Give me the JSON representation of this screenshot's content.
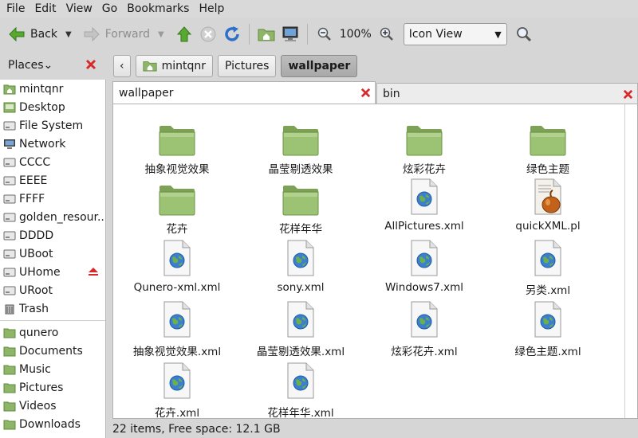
{
  "menu": [
    "File",
    "Edit",
    "View",
    "Go",
    "Bookmarks",
    "Help"
  ],
  "toolbar": {
    "back_label": "Back",
    "forward_label": "Forward",
    "zoom": "100%",
    "view_mode": "Icon View"
  },
  "sidebar": {
    "title": "Places",
    "items": [
      {
        "label": "mintqnr",
        "icon": "home-folder-icon"
      },
      {
        "label": "Desktop",
        "icon": "desktop-icon"
      },
      {
        "label": "File System",
        "icon": "drive-icon"
      },
      {
        "label": "Network",
        "icon": "network-icon"
      },
      {
        "label": "CCCC",
        "icon": "drive-icon"
      },
      {
        "label": "EEEE",
        "icon": "drive-icon"
      },
      {
        "label": "FFFF",
        "icon": "drive-icon"
      },
      {
        "label": "golden_resour...",
        "icon": "drive-icon"
      },
      {
        "label": "DDDD",
        "icon": "drive-icon"
      },
      {
        "label": "UBoot",
        "icon": "drive-icon"
      },
      {
        "label": "UHome",
        "icon": "drive-icon"
      },
      {
        "label": "URoot",
        "icon": "drive-icon"
      },
      {
        "label": "Trash",
        "icon": "trash-icon"
      }
    ],
    "bookmarks": [
      {
        "label": "qunero",
        "icon": "folder-icon"
      },
      {
        "label": "Documents",
        "icon": "folder-icon"
      },
      {
        "label": "Music",
        "icon": "folder-icon"
      },
      {
        "label": "Pictures",
        "icon": "folder-icon"
      },
      {
        "label": "Videos",
        "icon": "folder-icon"
      },
      {
        "label": "Downloads",
        "icon": "folder-icon"
      }
    ]
  },
  "path": [
    "mintqnr",
    "Pictures",
    "wallpaper"
  ],
  "tabs": [
    {
      "label": "wallpaper",
      "active": true
    },
    {
      "label": "bin",
      "active": false
    }
  ],
  "files": [
    {
      "name": "抽象视觉效果",
      "type": "folder"
    },
    {
      "name": "晶莹剔透效果",
      "type": "folder"
    },
    {
      "name": "炫彩花卉",
      "type": "folder"
    },
    {
      "name": "绿色主题",
      "type": "folder"
    },
    {
      "name": "花卉",
      "type": "folder"
    },
    {
      "name": "花样年华",
      "type": "folder"
    },
    {
      "name": "AllPictures.xml",
      "type": "xml"
    },
    {
      "name": "quickXML.pl",
      "type": "perl"
    },
    {
      "name": "Qunero-xml.xml",
      "type": "xml"
    },
    {
      "name": "sony.xml",
      "type": "xml"
    },
    {
      "name": "Windows7.xml",
      "type": "xml"
    },
    {
      "name": "另类.xml",
      "type": "xml"
    },
    {
      "name": "抽象视觉效果.xml",
      "type": "xml"
    },
    {
      "name": "晶莹剔透效果.xml",
      "type": "xml"
    },
    {
      "name": "炫彩花卉.xml",
      "type": "xml"
    },
    {
      "name": "绿色主题.xml",
      "type": "xml"
    },
    {
      "name": "花卉.xml",
      "type": "xml"
    },
    {
      "name": "花样年华.xml",
      "type": "xml"
    }
  ],
  "status": "22 items, Free space: 12.1 GB",
  "colors": {
    "folder": "#8fb569",
    "close": "#d62b2b",
    "accent_green": "#4f9a2b",
    "accent_blue": "#2e6fc9"
  }
}
